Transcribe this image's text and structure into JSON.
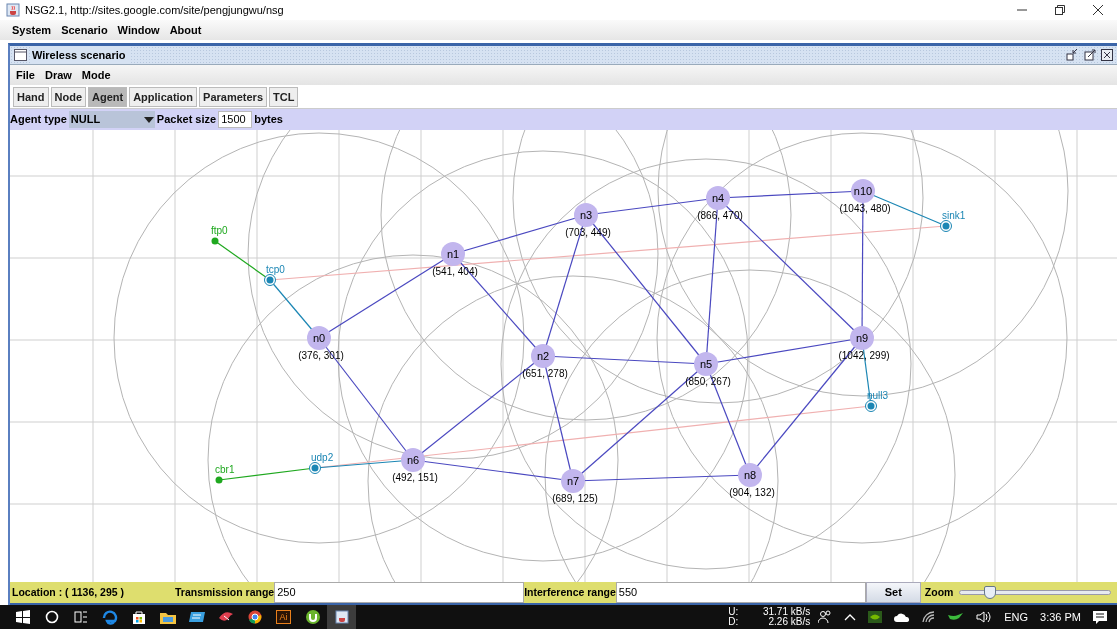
{
  "app_window": {
    "title": "NSG2.1, http://sites.google.com/site/pengjungwu/nsg"
  },
  "menu": [
    "System",
    "Scenario",
    "Window",
    "About"
  ],
  "scenario_window": {
    "title": "Wireless scenario",
    "menu": [
      "File",
      "Draw",
      "Mode"
    ]
  },
  "tools": [
    {
      "label": "Hand",
      "selected": false
    },
    {
      "label": "Node",
      "selected": false
    },
    {
      "label": "Agent",
      "selected": true
    },
    {
      "label": "Application",
      "selected": false
    },
    {
      "label": "Parameters",
      "selected": false
    },
    {
      "label": "TCL",
      "selected": false
    }
  ],
  "agent_bar": {
    "agent_type_label": "Agent type",
    "agent_type": "NULL",
    "packet_size_label": "Packet size",
    "packet_size": "1500",
    "unit": "bytes"
  },
  "nodes": [
    {
      "label": "n10",
      "coords": "(1043, 480)"
    },
    {
      "label": "n4",
      "coords": "(866, 470)"
    },
    {
      "label": "n3",
      "coords": "(703, 449)"
    },
    {
      "label": "n1",
      "coords": "(541, 404)"
    },
    {
      "label": "n0",
      "coords": "(376, 301)"
    },
    {
      "label": "n9",
      "coords": "(1042, 299)"
    },
    {
      "label": "n2",
      "coords": "(651, 278)"
    },
    {
      "label": "n5",
      "coords": "(850, 267)"
    },
    {
      "label": "n6",
      "coords": "(492, 151)"
    },
    {
      "label": "n8",
      "coords": "(904, 132)"
    },
    {
      "label": "n7",
      "coords": "(689, 125)"
    }
  ],
  "agents": [
    {
      "label": "sink1",
      "kind": "transport"
    },
    {
      "label": "ftp0",
      "kind": "application"
    },
    {
      "label": "tcp0",
      "kind": "transport"
    },
    {
      "label": "null3",
      "kind": "transport"
    },
    {
      "label": "udp2",
      "kind": "transport"
    },
    {
      "label": "cbr1",
      "kind": "application"
    }
  ],
  "status": {
    "location": "Location : ( 1136, 295 )",
    "tx_label": "Transmission range",
    "tx_value": "250",
    "if_label": "Interference range",
    "if_value": "550",
    "set": "Set",
    "zoom_label": "Zoom",
    "zoom": {
      "level": 0.2
    }
  },
  "taskbar": {
    "ai_badge": "Ai",
    "upload_label": "U:",
    "upload": "31.71 kB/s",
    "download_label": "D:",
    "download": "2.26 kB/s",
    "language": "ENG",
    "time": "3:36 PM"
  }
}
